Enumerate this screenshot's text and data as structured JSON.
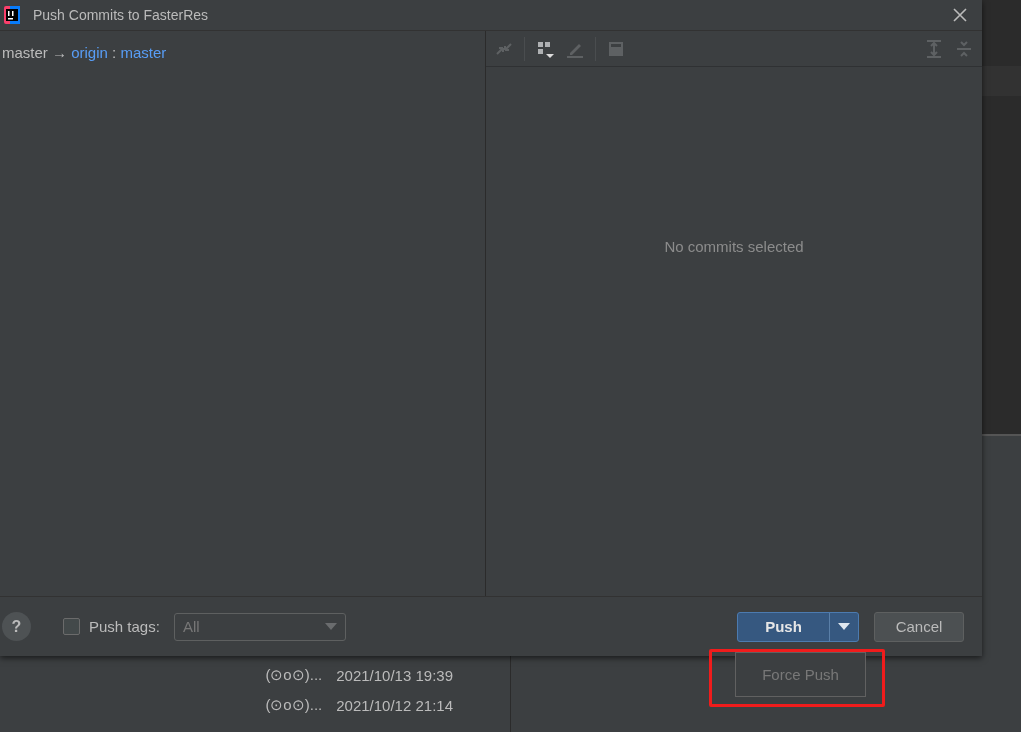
{
  "window": {
    "title": "Push Commits to FasterRes"
  },
  "push_spec": {
    "local_branch": "master",
    "arrow": "→",
    "remote": "origin",
    "separator": ":",
    "remote_branch": "master"
  },
  "details": {
    "empty_text": "No commits selected"
  },
  "footer": {
    "help": "?",
    "push_tags": {
      "label": "Push tags:",
      "checked": false
    },
    "tags_dropdown": {
      "value": "All",
      "disabled": true
    },
    "push_button": "Push",
    "cancel_button": "Cancel"
  },
  "push_menu": {
    "items": [
      {
        "label": "Force Push",
        "disabled": true
      }
    ]
  },
  "background_log": {
    "rows": [
      {
        "author": "(⊙o⊙)...",
        "date": "2021/10/13 19:39"
      },
      {
        "author": "(⊙o⊙)...",
        "date": "2021/10/12 21:14"
      }
    ]
  }
}
